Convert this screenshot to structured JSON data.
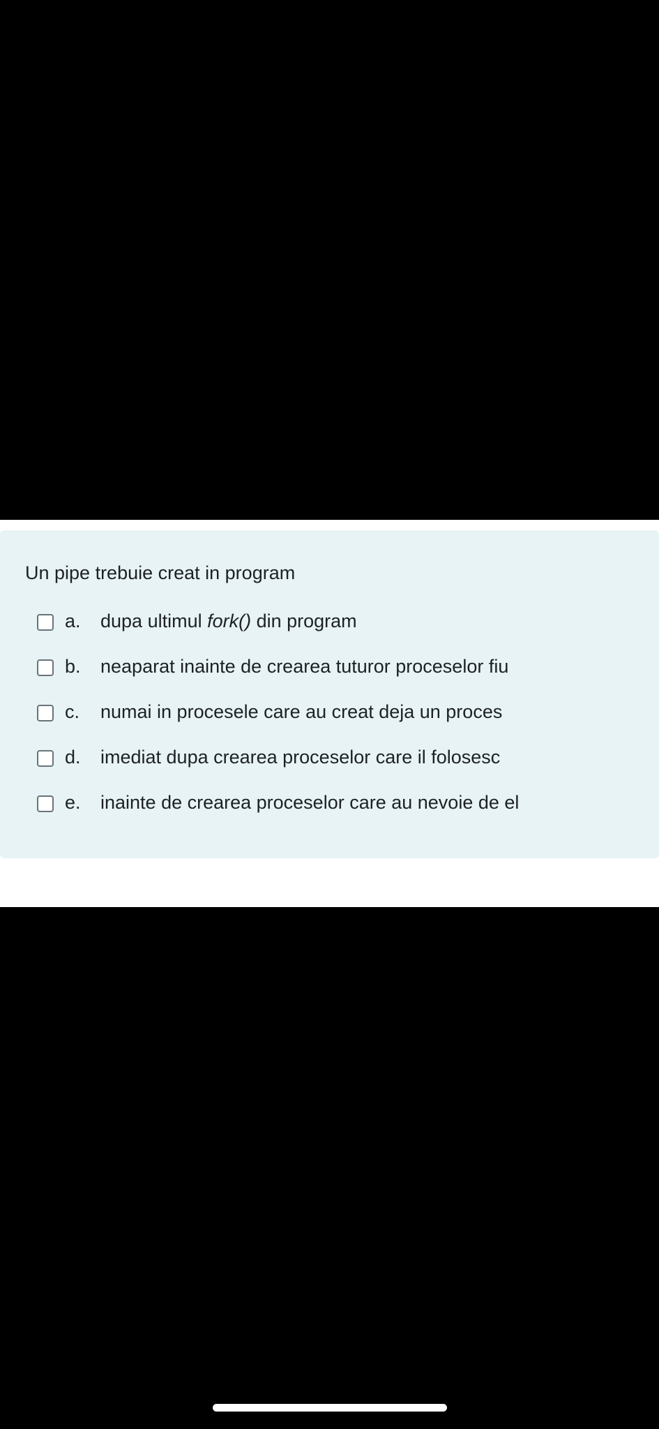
{
  "question": {
    "text": "Un pipe trebuie creat in program"
  },
  "answers": [
    {
      "letter": "a.",
      "text_before": "dupa ultimul ",
      "text_italic": "fork()",
      "text_after": " din program",
      "checked": false
    },
    {
      "letter": "b.",
      "text": "neaparat inainte de crearea tuturor proceselor fiu",
      "checked": false
    },
    {
      "letter": "c.",
      "text": "numai in procesele care au creat deja un proces",
      "checked": false
    },
    {
      "letter": "d.",
      "text": "imediat dupa crearea proceselor care il folosesc",
      "checked": false
    },
    {
      "letter": "e.",
      "text": "inainte de crearea proceselor care au nevoie de el",
      "checked": false
    }
  ],
  "colors": {
    "card_background": "#e7f3f5",
    "text": "#1d2125",
    "checkbox_border": "#6a737b",
    "screen_background": "#000000"
  },
  "icons": {
    "checkbox": "checkbox-unchecked-icon"
  }
}
